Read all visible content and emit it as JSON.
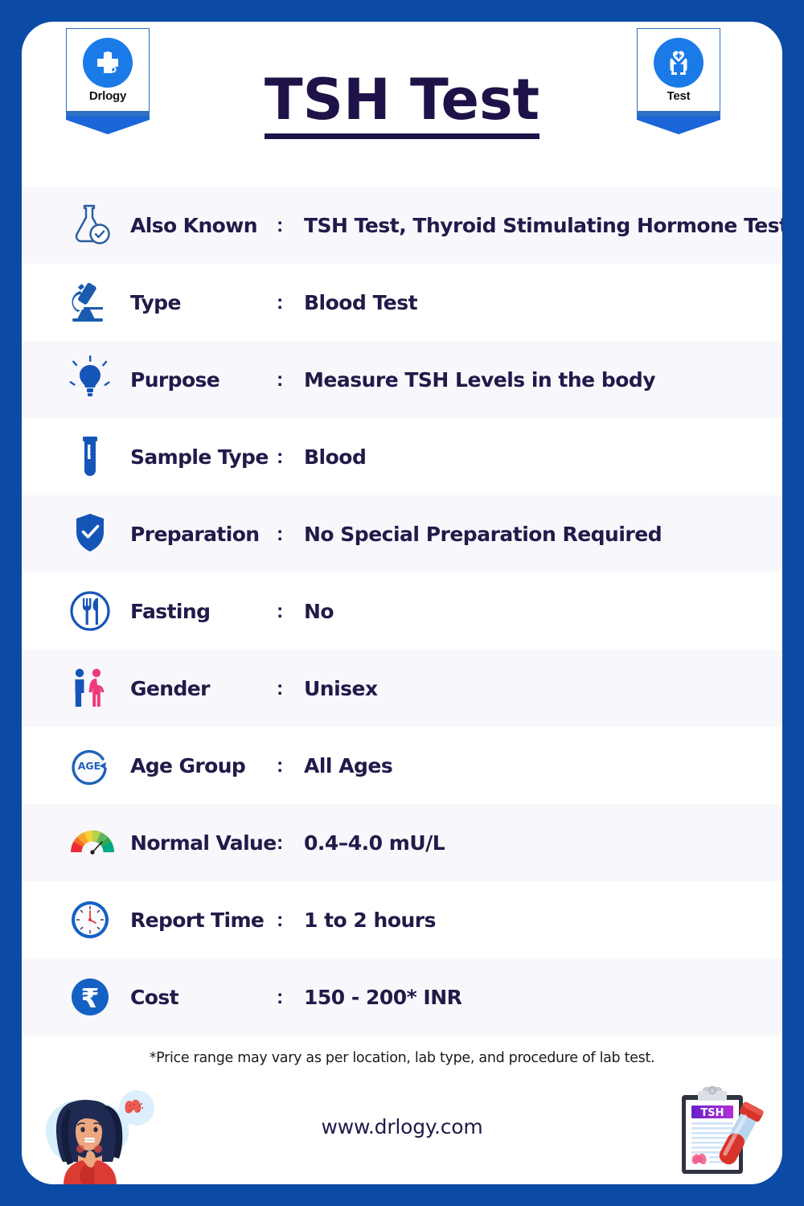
{
  "poster": {
    "border_color": "#0b4ba5",
    "card_bg": "#ffffff",
    "title": "TSH Test",
    "title_color": "#1e1248"
  },
  "header": {
    "left_badge": {
      "icon": "stethoscope-cross-icon",
      "label": "Drlogy"
    },
    "right_badge": {
      "icon": "hands-heart-cross-icon",
      "label": "Test"
    }
  },
  "table": {
    "colon": ":",
    "rows": [
      {
        "icon": "flask-check-icon",
        "label": "Also Known",
        "value": "TSH Test, Thyroid Stimulating Hormone Test"
      },
      {
        "icon": "microscope-icon",
        "label": "Type",
        "value": "Blood Test"
      },
      {
        "icon": "lightbulb-icon",
        "label": "Purpose",
        "value": "Measure TSH Levels in the body"
      },
      {
        "icon": "test-tube-icon",
        "label": "Sample Type",
        "value": "Blood"
      },
      {
        "icon": "shield-check-icon",
        "label": "Preparation",
        "value": "No Special Preparation Required"
      },
      {
        "icon": "no-food-icon",
        "label": "Fasting",
        "value": "No"
      },
      {
        "icon": "male-female-icon",
        "label": "Gender",
        "value": "Unisex"
      },
      {
        "icon": "age-circle-icon",
        "label": "Age Group",
        "value": "All Ages"
      },
      {
        "icon": "gauge-meter-icon",
        "label": "Normal Value",
        "value": "0.4–4.0 mU/L"
      },
      {
        "icon": "clock-icon",
        "label": "Report Time",
        "value": "1 to 2 hours"
      },
      {
        "icon": "rupee-coin-icon",
        "label": "Cost",
        "value": "150 - 200* INR"
      }
    ]
  },
  "disclaimer": "*Price range may vary as per location, lab type, and procedure of lab test.",
  "footer": {
    "url": "www.drlogy.com",
    "left_art": "woman-thyroid-illustration",
    "right_art": "tsh-clipboard-blood-tube-illustration"
  },
  "colors": {
    "brand_blue": "#0b4ba5",
    "icon_blue": "#1a5bb0",
    "accent_blue": "#1a7ae8",
    "text_navy": "#221a49",
    "row_alt": "#f8f7fc",
    "female_pink": "#ee3a7e"
  }
}
